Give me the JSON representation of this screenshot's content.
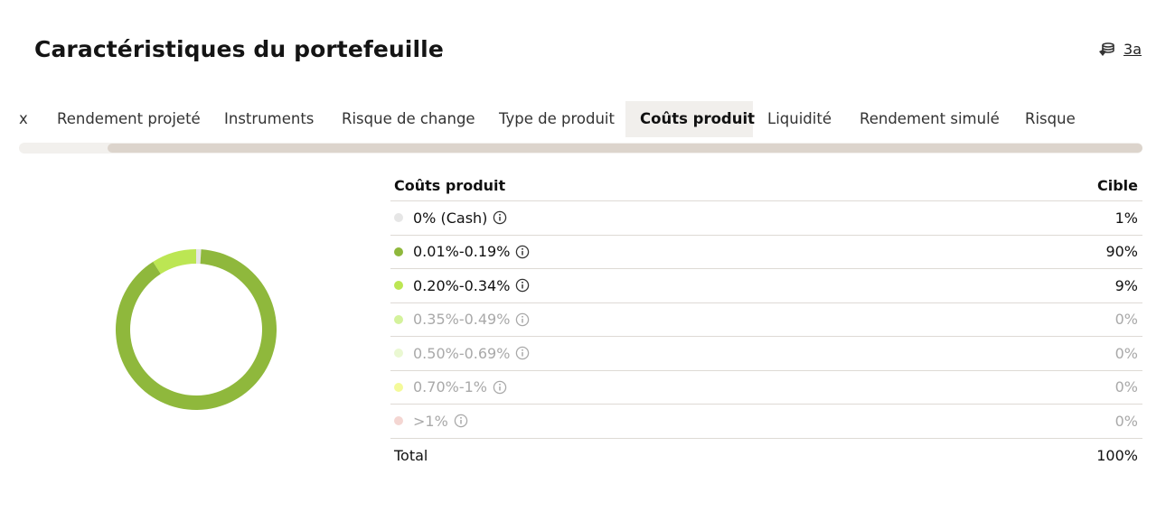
{
  "header": {
    "title": "Caractéristiques du portefeuille",
    "horizon_label": "3a",
    "horizon_icon": "coin-stack-icon"
  },
  "tabs": [
    {
      "label": "x",
      "active": false
    },
    {
      "label": "Rendement projeté",
      "active": false
    },
    {
      "label": "Instruments",
      "active": false
    },
    {
      "label": "Risque de change",
      "active": false
    },
    {
      "label": "Type de produit",
      "active": false
    },
    {
      "label": "Coûts produit",
      "active": true
    },
    {
      "label": "Liquidité",
      "active": false
    },
    {
      "label": "Rendement simulé",
      "active": false
    },
    {
      "label": "Risque",
      "active": false
    }
  ],
  "scrollbar": {
    "position": 0.08
  },
  "table": {
    "header_label": "Coûts produit",
    "header_value": "Cible",
    "rows": [
      {
        "label": "0% (Cash)",
        "value": "1%",
        "color": "#e6e6e6",
        "muted": false
      },
      {
        "label": "0.01%-0.19%",
        "value": "90%",
        "color": "#8fb83c",
        "muted": false
      },
      {
        "label": "0.20%-0.34%",
        "value": "9%",
        "color": "#bce653",
        "muted": false
      },
      {
        "label": "0.35%-0.49%",
        "value": "0%",
        "color": "#d4f29c",
        "muted": true
      },
      {
        "label": "0.50%-0.69%",
        "value": "0%",
        "color": "#eaf8d2",
        "muted": true
      },
      {
        "label": "0.70%-1%",
        "value": "0%",
        "color": "#f4fa9a",
        "muted": true
      },
      {
        "label": ">1%",
        "value": "0%",
        "color": "#f4d6d2",
        "muted": true
      }
    ],
    "total_label": "Total",
    "total_value": "100%"
  },
  "chart_data": {
    "type": "pie",
    "categories": [
      "0% (Cash)",
      "0.01%-0.19%",
      "0.20%-0.34%",
      "0.35%-0.49%",
      "0.50%-0.69%",
      "0.70%-1%",
      ">1%"
    ],
    "values": [
      1,
      90,
      9,
      0,
      0,
      0,
      0
    ],
    "colors": [
      "#e6e6e6",
      "#8fb83c",
      "#bce653",
      "#d4f29c",
      "#eaf8d2",
      "#f4fa9a",
      "#f4d6d2"
    ],
    "style": "donut"
  }
}
